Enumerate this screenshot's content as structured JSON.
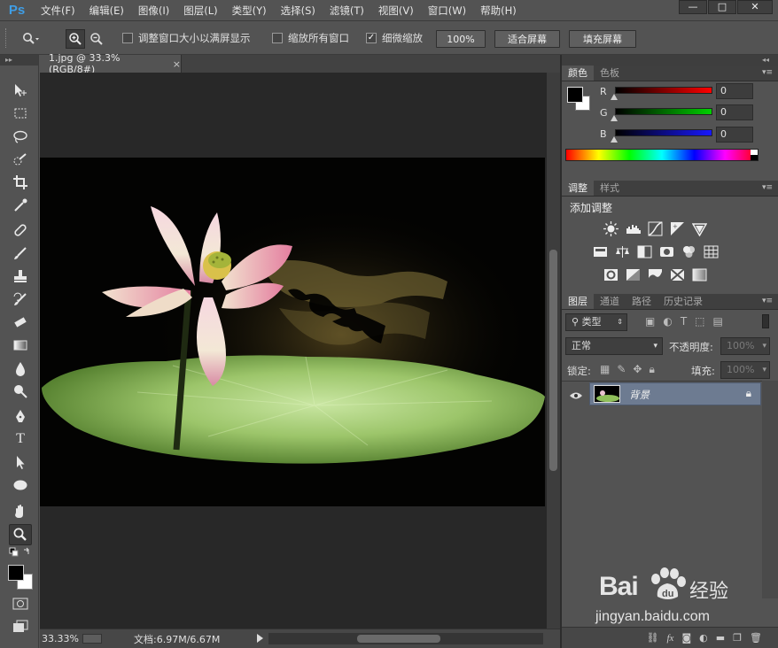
{
  "app": {
    "logo": "Ps",
    "menus": [
      "文件(F)",
      "编辑(E)",
      "图像(I)",
      "图层(L)",
      "类型(Y)",
      "选择(S)",
      "滤镜(T)",
      "视图(V)",
      "窗口(W)",
      "帮助(H)"
    ],
    "window_controls": [
      "—",
      "□",
      "✕"
    ]
  },
  "options": {
    "resize_windows_label": "调整窗口大小以满屏显示",
    "resize_windows_checked": false,
    "zoom_all_label": "缩放所有窗口",
    "zoom_all_checked": false,
    "scrubby_zoom_label": "细微缩放",
    "scrubby_zoom_checked": true,
    "btn_100": "100%",
    "btn_fit": "适合屏幕",
    "btn_fill": "填充屏幕"
  },
  "document": {
    "tab_title": "1.jpg @ 33.3%(RGB/8#)",
    "tab_close": "×"
  },
  "status": {
    "zoom": "33.33%",
    "doc_info": "文档:6.97M/6.67M"
  },
  "color_panel": {
    "tabs": [
      "颜色",
      "色板"
    ],
    "channels": [
      {
        "label": "R",
        "value": "0"
      },
      {
        "label": "G",
        "value": "0"
      },
      {
        "label": "B",
        "value": "0"
      }
    ],
    "foreground": "#000000",
    "background": "#ffffff"
  },
  "adjust_panel": {
    "tabs": [
      "调整",
      "样式"
    ],
    "title": "添加调整"
  },
  "layers_panel": {
    "tabs": [
      "图层",
      "通道",
      "路径",
      "历史记录"
    ],
    "filter_label": "类型",
    "blend_mode": "正常",
    "opacity_label": "不透明度:",
    "opacity_value": "100%",
    "lock_label": "锁定:",
    "fill_label": "填充:",
    "fill_value": "100%",
    "layers": [
      {
        "name": "背景",
        "visible": true,
        "locked": true
      }
    ]
  },
  "watermark": {
    "brand": "Bai",
    "brand_suffix": "经验",
    "url": "jingyan.baidu.com"
  }
}
